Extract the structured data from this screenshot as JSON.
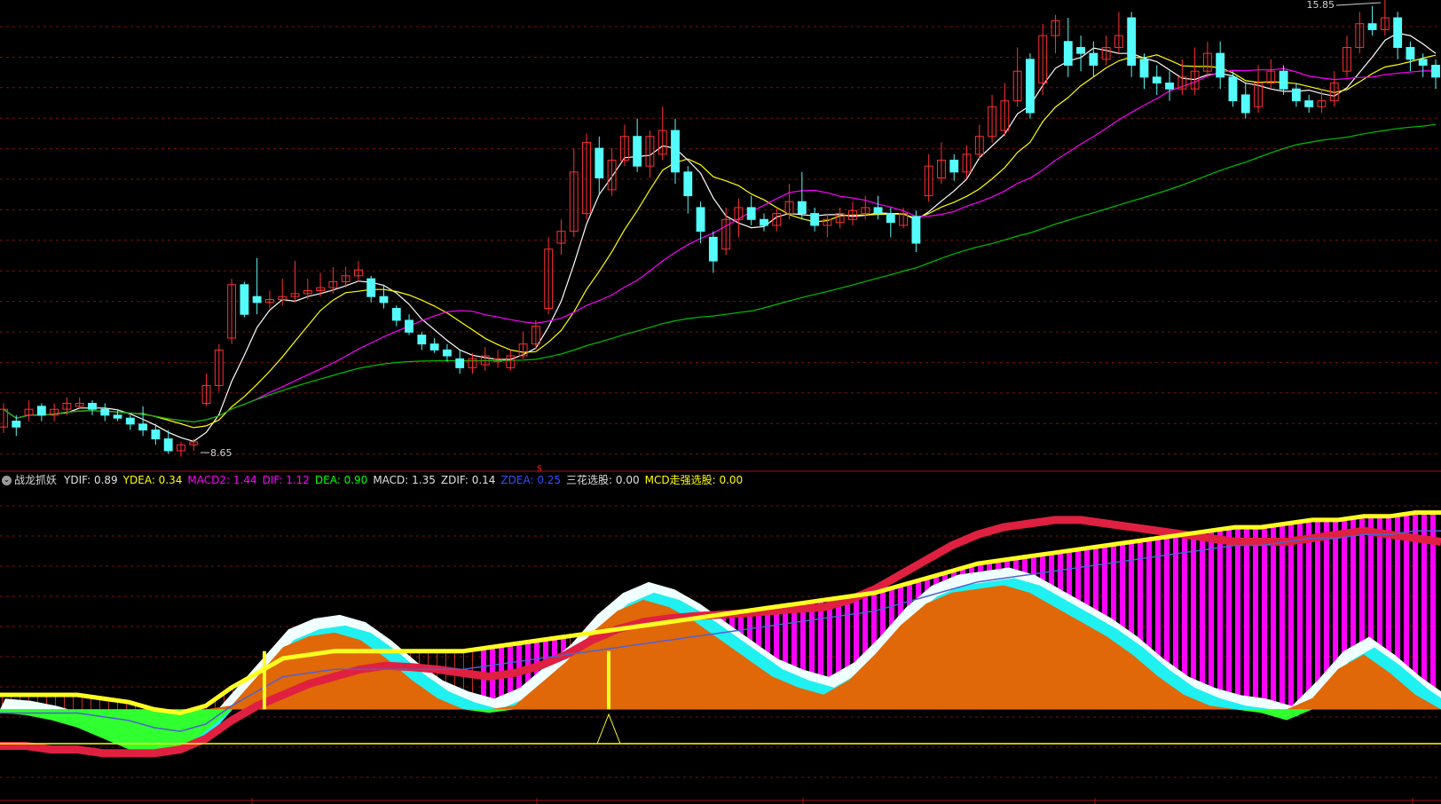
{
  "colors": {
    "background": "#000000",
    "grid": "#7a1010",
    "candle_up": "#ff3030",
    "candle_down": "#54fcfc",
    "ma_short": "#ffffff",
    "ma_mid": "#ffff00",
    "ma_long": "#ff00ff",
    "ma_very_long": "#00c000"
  },
  "price_chart": {
    "high_label": "15.85",
    "low_label": "8.65",
    "marker_label": "$"
  },
  "indicator_panel": {
    "toggle_icon": "circle-chevron-down-icon",
    "name": "战龙抓妖",
    "legend": [
      {
        "text": "YDIF: 0.89",
        "color": "#e0e0e0"
      },
      {
        "text": "YDEA: 0.34",
        "color": "#ffff00"
      },
      {
        "text": "MACD2: 1.44",
        "color": "#ff00ff"
      },
      {
        "text": "DIF: 1.12",
        "color": "#ff00ff"
      },
      {
        "text": "DEA: 0.90",
        "color": "#00ff00"
      },
      {
        "text": "MACD: 1.35",
        "color": "#e0e0e0"
      },
      {
        "text": "ZDIF: 0.14",
        "color": "#e0e0e0"
      },
      {
        "text": "ZDEA: 0.25",
        "color": "#3050ff"
      },
      {
        "text": "三花选股: 0.00",
        "color": "#e0e0e0"
      },
      {
        "text": "MCD走强选股: 0.00",
        "color": "#ffff00"
      }
    ]
  },
  "chart_data": [
    {
      "type": "candlestick",
      "title": "",
      "ylim": [
        8.3,
        16.2
      ],
      "series": [
        {
          "name": "candles",
          "values": [
            [
              9.0,
              9.3,
              9.4,
              8.9
            ],
            [
              9.1,
              9.0,
              9.2,
              8.85
            ],
            [
              9.2,
              9.3,
              9.45,
              9.1
            ],
            [
              9.35,
              9.2,
              9.4,
              9.1
            ],
            [
              9.2,
              9.3,
              9.4,
              9.1
            ],
            [
              9.3,
              9.4,
              9.5,
              9.2
            ],
            [
              9.35,
              9.4,
              9.5,
              9.3
            ],
            [
              9.4,
              9.3,
              9.45,
              9.2
            ],
            [
              9.3,
              9.2,
              9.4,
              9.1
            ],
            [
              9.2,
              9.15,
              9.3,
              9.1
            ],
            [
              9.15,
              9.05,
              9.2,
              8.95
            ],
            [
              9.05,
              8.95,
              9.35,
              8.85
            ],
            [
              8.95,
              8.8,
              9.05,
              8.7
            ],
            [
              8.8,
              8.6,
              8.95,
              8.55
            ],
            [
              8.6,
              8.7,
              8.75,
              8.5
            ],
            [
              8.7,
              8.75,
              8.8,
              8.6
            ],
            [
              9.4,
              9.7,
              9.9,
              9.35
            ],
            [
              9.7,
              10.3,
              10.4,
              9.6
            ],
            [
              10.5,
              11.4,
              11.5,
              10.4
            ],
            [
              11.4,
              10.9,
              11.45,
              10.85
            ],
            [
              11.2,
              11.1,
              11.85,
              10.9
            ],
            [
              11.1,
              11.15,
              11.3,
              11.0
            ],
            [
              11.15,
              11.2,
              11.5,
              11.05
            ],
            [
              11.2,
              11.25,
              11.8,
              11.1
            ],
            [
              11.25,
              11.3,
              11.5,
              11.15
            ],
            [
              11.3,
              11.35,
              11.6,
              11.2
            ],
            [
              11.35,
              11.45,
              11.7,
              11.25
            ],
            [
              11.45,
              11.55,
              11.7,
              11.35
            ],
            [
              11.55,
              11.65,
              11.8,
              11.45
            ],
            [
              11.5,
              11.2,
              11.55,
              11.1
            ],
            [
              11.2,
              11.1,
              11.4,
              11.0
            ],
            [
              11.0,
              10.8,
              11.05,
              10.7
            ],
            [
              10.8,
              10.6,
              10.9,
              10.55
            ],
            [
              10.55,
              10.4,
              10.6,
              10.3
            ],
            [
              10.4,
              10.3,
              10.5,
              10.25
            ],
            [
              10.3,
              10.2,
              10.4,
              10.1
            ],
            [
              10.15,
              10.0,
              10.3,
              9.9
            ],
            [
              10.0,
              10.15,
              10.25,
              9.9
            ],
            [
              10.05,
              10.2,
              10.35,
              9.95
            ],
            [
              10.1,
              10.15,
              10.3,
              10.0
            ],
            [
              10.0,
              10.2,
              10.3,
              9.95
            ],
            [
              10.2,
              10.4,
              10.6,
              10.15
            ],
            [
              10.4,
              10.7,
              10.8,
              10.3
            ],
            [
              11.0,
              12.0,
              12.2,
              10.9
            ],
            [
              12.1,
              12.3,
              12.5,
              11.9
            ],
            [
              12.3,
              13.3,
              13.7,
              12.2
            ],
            [
              12.6,
              13.8,
              13.95,
              12.5
            ],
            [
              13.7,
              13.2,
              13.9,
              12.9
            ],
            [
              13.0,
              13.5,
              13.7,
              12.9
            ],
            [
              13.5,
              13.9,
              14.1,
              13.4
            ],
            [
              13.9,
              13.4,
              14.2,
              13.3
            ],
            [
              13.4,
              13.9,
              14.0,
              13.2
            ],
            [
              13.6,
              14.0,
              14.4,
              13.5
            ],
            [
              14.0,
              13.3,
              14.2,
              13.1
            ],
            [
              13.3,
              12.9,
              13.4,
              12.6
            ],
            [
              12.7,
              12.3,
              12.8,
              12.1
            ],
            [
              12.2,
              11.8,
              12.3,
              11.6
            ],
            [
              12.0,
              12.5,
              12.7,
              11.9
            ],
            [
              12.5,
              12.7,
              12.85,
              12.2
            ],
            [
              12.7,
              12.5,
              12.9,
              12.4
            ],
            [
              12.5,
              12.4,
              12.6,
              12.3
            ],
            [
              12.4,
              12.6,
              12.7,
              12.3
            ],
            [
              12.6,
              12.8,
              13.1,
              12.5
            ],
            [
              12.8,
              12.6,
              13.3,
              12.5
            ],
            [
              12.6,
              12.4,
              12.7,
              12.3
            ],
            [
              12.4,
              12.5,
              12.6,
              12.2
            ],
            [
              12.45,
              12.6,
              12.7,
              12.35
            ],
            [
              12.5,
              12.65,
              12.8,
              12.4
            ],
            [
              12.6,
              12.7,
              12.9,
              12.5
            ],
            [
              12.7,
              12.6,
              12.9,
              12.5
            ],
            [
              12.6,
              12.45,
              12.7,
              12.2
            ],
            [
              12.4,
              12.6,
              12.7,
              12.35
            ],
            [
              12.55,
              12.1,
              12.65,
              11.95
            ],
            [
              12.9,
              13.4,
              13.6,
              12.8
            ],
            [
              13.2,
              13.5,
              13.8,
              13.1
            ],
            [
              13.5,
              13.3,
              13.6,
              13.15
            ],
            [
              13.3,
              13.6,
              13.75,
              13.2
            ],
            [
              13.6,
              13.9,
              14.1,
              13.5
            ],
            [
              13.9,
              14.4,
              14.6,
              13.8
            ],
            [
              14.0,
              14.5,
              14.8,
              13.9
            ],
            [
              14.5,
              15.0,
              15.4,
              14.4
            ],
            [
              15.2,
              14.3,
              15.3,
              14.2
            ],
            [
              14.8,
              15.6,
              15.8,
              14.6
            ],
            [
              15.6,
              15.85,
              15.95,
              15.3
            ],
            [
              15.5,
              15.1,
              15.9,
              14.9
            ],
            [
              15.4,
              15.3,
              15.6,
              15.0
            ],
            [
              15.3,
              15.1,
              15.5,
              14.9
            ],
            [
              15.2,
              15.4,
              15.6,
              15.1
            ],
            [
              15.4,
              15.6,
              16.0,
              15.3
            ],
            [
              15.9,
              15.1,
              16.0,
              14.9
            ],
            [
              15.2,
              14.9,
              15.3,
              14.7
            ],
            [
              14.9,
              14.8,
              15.1,
              14.6
            ],
            [
              14.8,
              14.7,
              15.0,
              14.5
            ],
            [
              14.7,
              14.9,
              15.2,
              14.6
            ],
            [
              14.7,
              15.0,
              15.4,
              14.6
            ],
            [
              15.0,
              15.3,
              15.5,
              14.9
            ],
            [
              15.3,
              14.9,
              15.5,
              14.7
            ],
            [
              14.9,
              14.5,
              15.0,
              14.4
            ],
            [
              14.6,
              14.3,
              14.8,
              14.2
            ],
            [
              14.4,
              14.8,
              15.1,
              14.3
            ],
            [
              14.8,
              15.0,
              15.2,
              14.7
            ],
            [
              15.0,
              14.7,
              15.1,
              14.6
            ],
            [
              14.7,
              14.5,
              14.8,
              14.4
            ],
            [
              14.5,
              14.4,
              14.6,
              14.3
            ],
            [
              14.4,
              14.5,
              14.7,
              14.3
            ],
            [
              14.5,
              14.8,
              15.0,
              14.4
            ],
            [
              15.0,
              15.4,
              15.6,
              14.9
            ],
            [
              15.4,
              15.8,
              16.0,
              15.3
            ],
            [
              15.8,
              15.7,
              16.1,
              15.6
            ],
            [
              15.7,
              15.9,
              16.2,
              15.6
            ],
            [
              15.9,
              15.4,
              16.0,
              15.2
            ],
            [
              15.4,
              15.2,
              15.5,
              15.0
            ],
            [
              15.2,
              15.1,
              15.3,
              14.9
            ],
            [
              15.1,
              14.9,
              15.2,
              14.7
            ]
          ]
        }
      ]
    },
    {
      "type": "area",
      "title": "",
      "ylim": [
        -1.2,
        3.0
      ],
      "series": [
        {
          "name": "DIF",
          "values": [
            0.05,
            0.02,
            -0.05,
            -0.15,
            -0.3,
            -0.45,
            -0.55,
            -0.45,
            -0.2,
            0.2,
            0.6,
            1.0,
            1.15,
            1.2,
            1.1,
            0.85,
            0.55,
            0.3,
            0.15,
            0.05,
            0.2,
            0.5,
            0.8,
            1.2,
            1.5,
            1.65,
            1.55,
            1.35,
            1.1,
            0.85,
            0.6,
            0.45,
            0.35,
            0.55,
            0.9,
            1.3,
            1.6,
            1.75,
            1.8,
            1.85,
            1.75,
            1.55,
            1.35,
            1.15,
            0.9,
            0.6,
            0.35,
            0.2,
            0.1,
            0.05,
            -0.05,
            0.3,
            0.7,
            0.9,
            0.65,
            0.35,
            0.1
          ]
        },
        {
          "name": "DEA",
          "values": [
            -0.5,
            -0.5,
            -0.55,
            -0.55,
            -0.6,
            -0.6,
            -0.6,
            -0.55,
            -0.4,
            -0.15,
            0.05,
            0.2,
            0.35,
            0.45,
            0.55,
            0.6,
            0.58,
            0.55,
            0.5,
            0.45,
            0.5,
            0.6,
            0.75,
            0.95,
            1.1,
            1.2,
            1.25,
            1.28,
            1.3,
            1.32,
            1.35,
            1.38,
            1.4,
            1.5,
            1.65,
            1.85,
            2.05,
            2.25,
            2.4,
            2.5,
            2.55,
            2.6,
            2.6,
            2.55,
            2.5,
            2.45,
            2.4,
            2.35,
            2.3,
            2.3,
            2.3,
            2.35,
            2.4,
            2.45,
            2.4,
            2.35,
            2.3
          ]
        },
        {
          "name": "MACD2",
          "values": [
            0.2,
            0.2,
            0.2,
            0.2,
            0.15,
            0.1,
            0.0,
            -0.05,
            0.05,
            0.3,
            0.5,
            0.7,
            0.75,
            0.8,
            0.8,
            0.8,
            0.8,
            0.8,
            0.8,
            0.85,
            0.9,
            0.95,
            1.0,
            1.05,
            1.1,
            1.15,
            1.2,
            1.25,
            1.3,
            1.35,
            1.4,
            1.45,
            1.5,
            1.55,
            1.6,
            1.7,
            1.8,
            1.9,
            2.0,
            2.05,
            2.1,
            2.15,
            2.2,
            2.25,
            2.3,
            2.35,
            2.4,
            2.45,
            2.5,
            2.5,
            2.55,
            2.6,
            2.6,
            2.65,
            2.65,
            2.7,
            2.7
          ]
        }
      ]
    }
  ]
}
